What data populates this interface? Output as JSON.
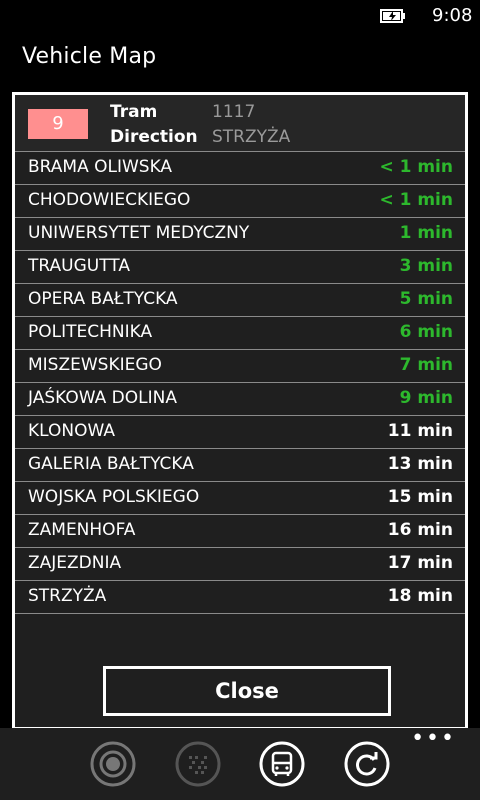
{
  "status_bar": {
    "time": "9:08",
    "battery_icon": "battery-charging-icon"
  },
  "app": {
    "title": "Vehicle Map"
  },
  "vehicle": {
    "line_number": "9",
    "line_color": "#ff8f8f",
    "type_label": "Tram",
    "vehicle_id": "1117",
    "direction_label": "Direction",
    "direction_value": "STRZYŻA"
  },
  "stops": [
    {
      "name": "BRAMA OLIWSKA",
      "eta": "< 1 min",
      "status": "soon"
    },
    {
      "name": "CHODOWIECKIEGO",
      "eta": "< 1 min",
      "status": "soon"
    },
    {
      "name": "UNIWERSYTET MEDYCZNY",
      "eta": "1 min",
      "status": "soon"
    },
    {
      "name": "TRAUGUTTA",
      "eta": "3 min",
      "status": "soon"
    },
    {
      "name": "OPERA BAŁTYCKA",
      "eta": "5 min",
      "status": "soon"
    },
    {
      "name": "POLITECHNIKA",
      "eta": "6 min",
      "status": "soon"
    },
    {
      "name": "MISZEWSKIEGO",
      "eta": "7 min",
      "status": "soon"
    },
    {
      "name": "JAŚKOWA DOLINA",
      "eta": "9 min",
      "status": "soon"
    },
    {
      "name": "KLONOWA",
      "eta": "11 min",
      "status": "later"
    },
    {
      "name": "GALERIA BAŁTYCKA",
      "eta": "13 min",
      "status": "later"
    },
    {
      "name": "WOJSKA POLSKIEGO",
      "eta": "15 min",
      "status": "later"
    },
    {
      "name": "ZAMENHOFA",
      "eta": "16 min",
      "status": "later"
    },
    {
      "name": "ZAJEZDNIA",
      "eta": "17 min",
      "status": "later"
    },
    {
      "name": "STRZYŻA",
      "eta": "18 min",
      "status": "later"
    }
  ],
  "colors": {
    "soon": "#2db82d",
    "later": "#ffffff"
  },
  "close_label": "Close",
  "app_bar": {
    "buttons": [
      {
        "icon": "record-icon",
        "name": "appbar-record-button",
        "enabled": true
      },
      {
        "icon": "dots-pattern-icon",
        "name": "appbar-pattern-button",
        "enabled": false
      },
      {
        "icon": "bus-icon",
        "name": "appbar-bus-button",
        "enabled": true
      },
      {
        "icon": "refresh-icon",
        "name": "appbar-refresh-button",
        "enabled": true
      }
    ],
    "more_icon": "ellipsis-icon"
  }
}
